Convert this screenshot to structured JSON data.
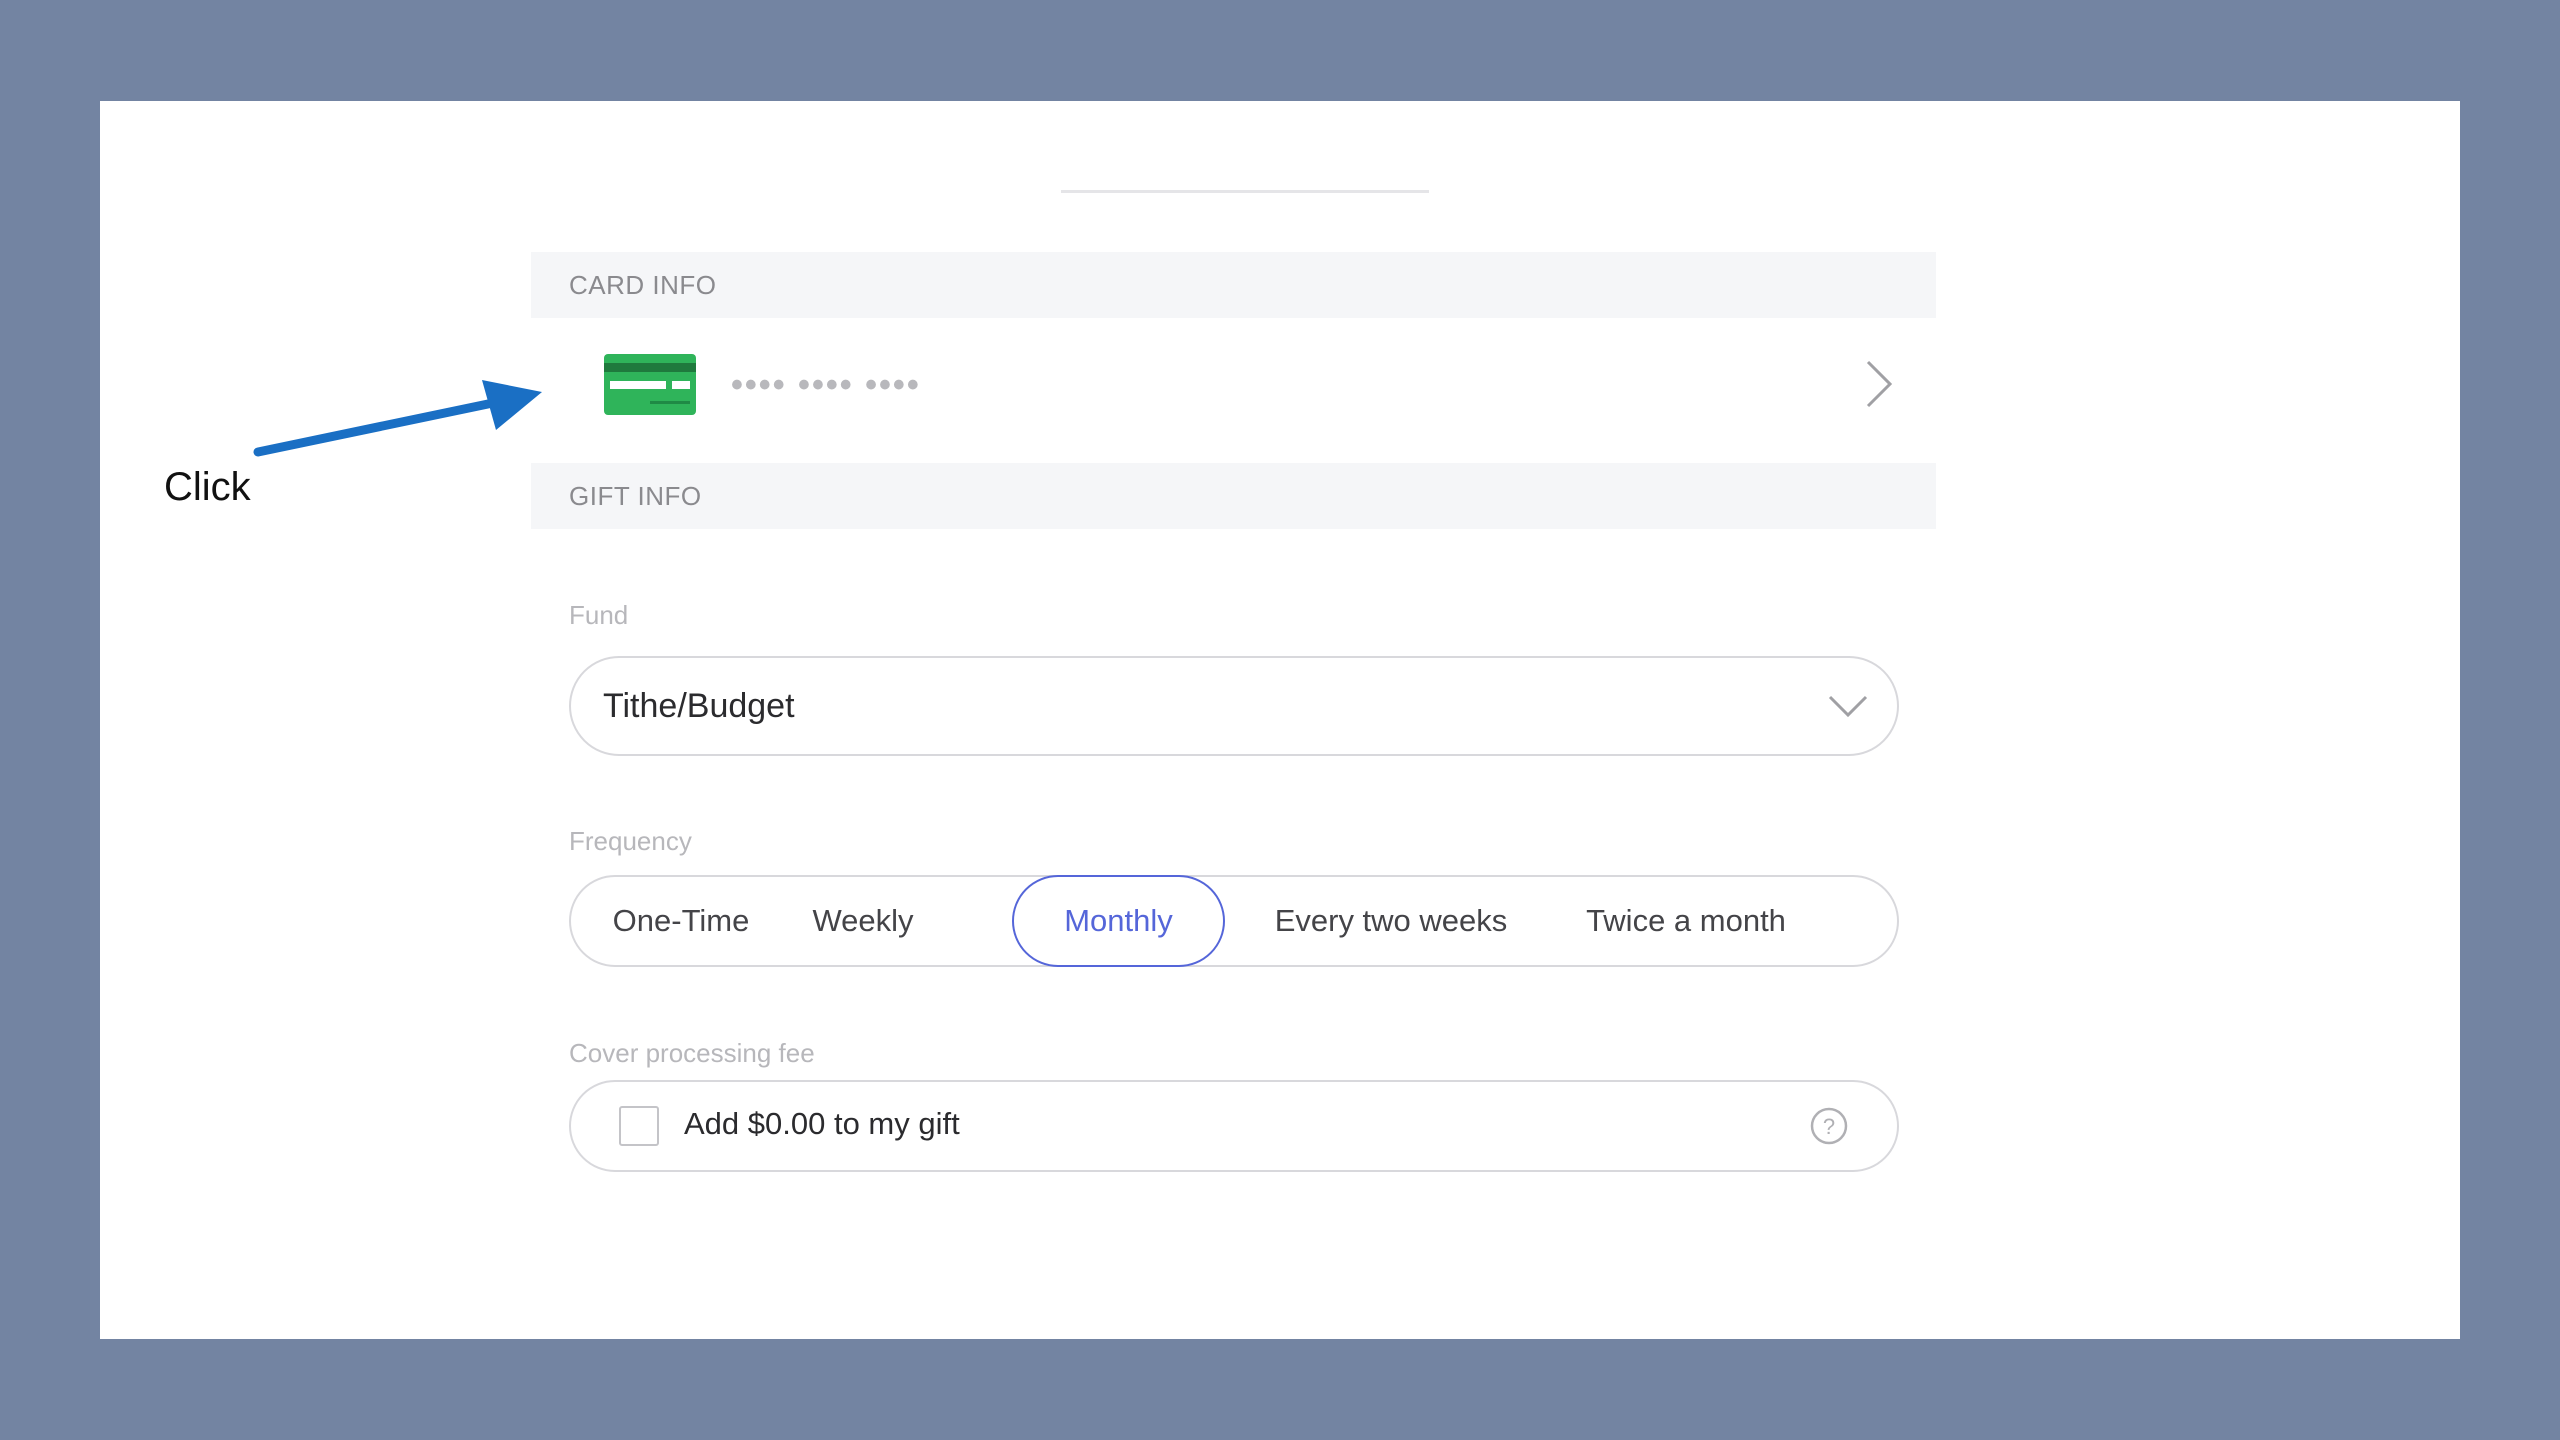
{
  "card_info": {
    "header": "CARD INFO",
    "card_number_masked": "•••• •••• ••••",
    "card_icon": "credit-card-icon",
    "card_color": "#2fb45a",
    "chevron_icon": "chevron-right-icon"
  },
  "gift_info": {
    "header": "GIFT INFO",
    "fund": {
      "label": "Fund",
      "value": "Tithe/Budget",
      "chevron_icon": "chevron-down-icon"
    },
    "frequency": {
      "label": "Frequency",
      "options": [
        "One-Time",
        "Weekly",
        "Monthly",
        "Every two weeks",
        "Twice a month"
      ],
      "selected": "Monthly",
      "accent_color": "#5566d9"
    },
    "processing_fee": {
      "label": "Cover processing fee",
      "checkbox_text": "Add $0.00 to my gift",
      "checked": false,
      "help_icon": "question-circle-icon"
    }
  },
  "annotation": {
    "text": "Click",
    "arrow_color": "#1a6fc4"
  },
  "colors": {
    "background": "#7384a2",
    "panel": "#ffffff",
    "section_header_bg": "#f5f6f8"
  }
}
